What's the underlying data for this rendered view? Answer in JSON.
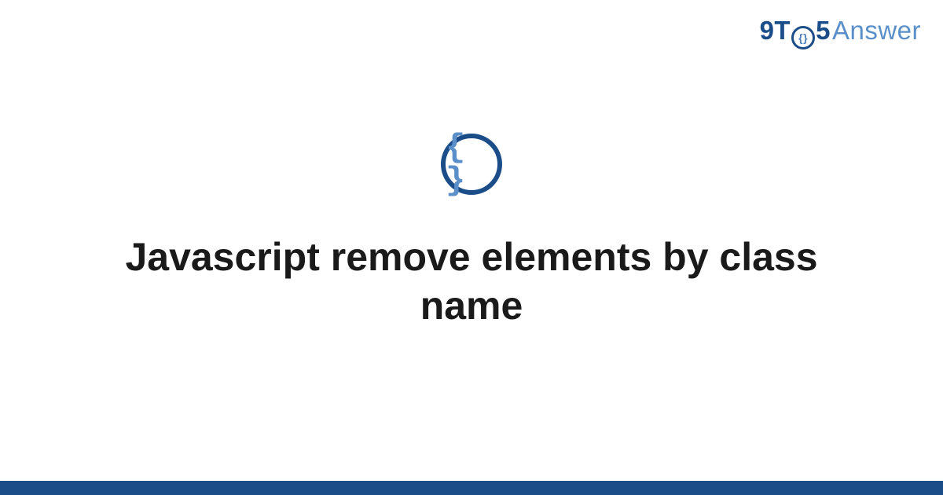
{
  "brand": {
    "part1": "9T",
    "ring_glyph": "{}",
    "part2": "5",
    "part3": "Answer"
  },
  "topic_icon_glyph": "{ }",
  "title": "Javascript remove elements by class name",
  "colors": {
    "primary": "#1b4d88",
    "accent": "#5a8fc9"
  }
}
